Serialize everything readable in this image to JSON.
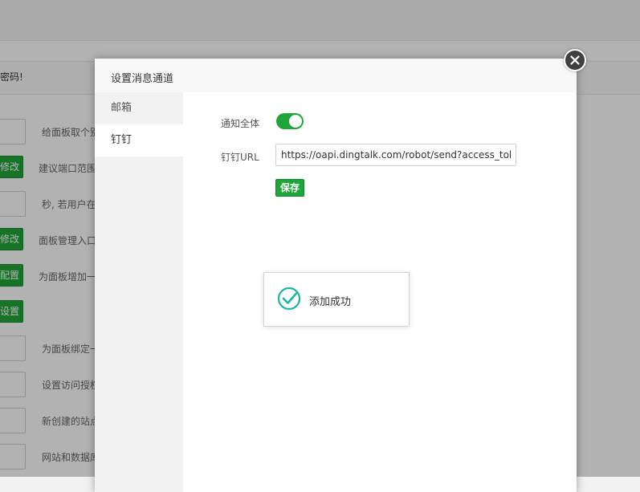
{
  "background": {
    "notice_text": "密码!",
    "rows": [
      {
        "kind": "input",
        "label": "给面板取个别"
      },
      {
        "kind": "button",
        "button": "修改",
        "label": "建议端口范围"
      },
      {
        "kind": "input",
        "label": "秒, 若用户在"
      },
      {
        "kind": "button",
        "button": "修改",
        "label": "面板管理入口"
      },
      {
        "kind": "button",
        "button": "配置",
        "label": "为面板增加一"
      },
      {
        "kind": "button",
        "button": "设置",
        "label": ""
      },
      {
        "kind": "input",
        "label": "为面板绑定一"
      },
      {
        "kind": "input",
        "label": "设置访问授权"
      },
      {
        "kind": "input",
        "label": "新创建的站点"
      },
      {
        "kind": "input",
        "label": "网站和数据库"
      }
    ]
  },
  "dialog": {
    "title": "设置消息通道",
    "tabs": [
      {
        "label": "邮箱",
        "active": false
      },
      {
        "label": "钉钉",
        "active": true
      }
    ],
    "notify_all_label": "通知全体",
    "notify_all_on": true,
    "url_label": "钉钉URL",
    "url_value": "https://oapi.dingtalk.com/robot/send?access_token=",
    "save_label": "保存"
  },
  "toast": {
    "message": "添加成功"
  },
  "colors": {
    "accent": "#20a53a",
    "toast_icon": "#1cb5a0",
    "close": "#404040"
  }
}
